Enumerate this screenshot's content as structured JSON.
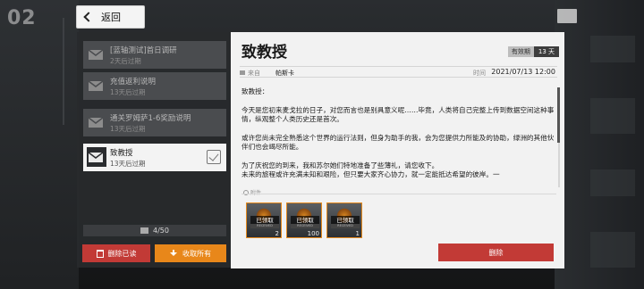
{
  "header": {
    "back_label": "返回"
  },
  "background": {
    "corner_number": "02"
  },
  "mail_list": {
    "items": [
      {
        "title": "[蓝轴测试]首日调研",
        "expiry": "2天后过期",
        "active": false
      },
      {
        "title": "充值返利说明",
        "expiry": "13天后过期",
        "active": false
      },
      {
        "title": "通关罗姆萨1-6奖励说明",
        "expiry": "13天后过期",
        "active": false
      },
      {
        "title": "致教授",
        "expiry": "13天后过期",
        "active": true
      }
    ],
    "count": "4/50",
    "delete_read_label": "删除已读",
    "claim_all_label": "收取所有"
  },
  "detail": {
    "title": "致教授",
    "expiry_label": "有效期",
    "expiry_value": "13 天",
    "from_label": "来自",
    "from_value": "帕斯卡",
    "time_label": "时间",
    "time_value": "2021/07/13 12:00",
    "body": [
      "致教授：",
      "今天是您初来麦戈拉的日子，对您而言也是别具意义呢……毕竟，人类将自己完整上传到数据空间这种事情，纵观整个人类历史还是首次。",
      "或许您尚未完全熟悉这个世界的运行法则，但身为助手的我，会为您提供力所能及的协助，绿洲的其他伙伴们也会竭尽所能。",
      "为了庆祝您的到来，我和苏尔她们特地准备了些薄礼，请您收下。\n未来的旅程或许充满未知和艰险，但只要大家齐心协力，就一定能抵达希望的彼岸。一"
    ],
    "attachment_label": "附件",
    "attachments": [
      {
        "status": "已领取",
        "status_en": "RECEIVED",
        "qty": "2"
      },
      {
        "status": "已领取",
        "status_en": "RECEIVED",
        "qty": "100"
      },
      {
        "status": "已领取",
        "status_en": "RECEIVED",
        "qty": "1"
      }
    ],
    "delete_label": "删除"
  },
  "colors": {
    "accent_orange": "#e8871a",
    "danger_red": "#c23a36",
    "panel_light": "#f2f2f2",
    "panel_dark": "#282a2d"
  }
}
